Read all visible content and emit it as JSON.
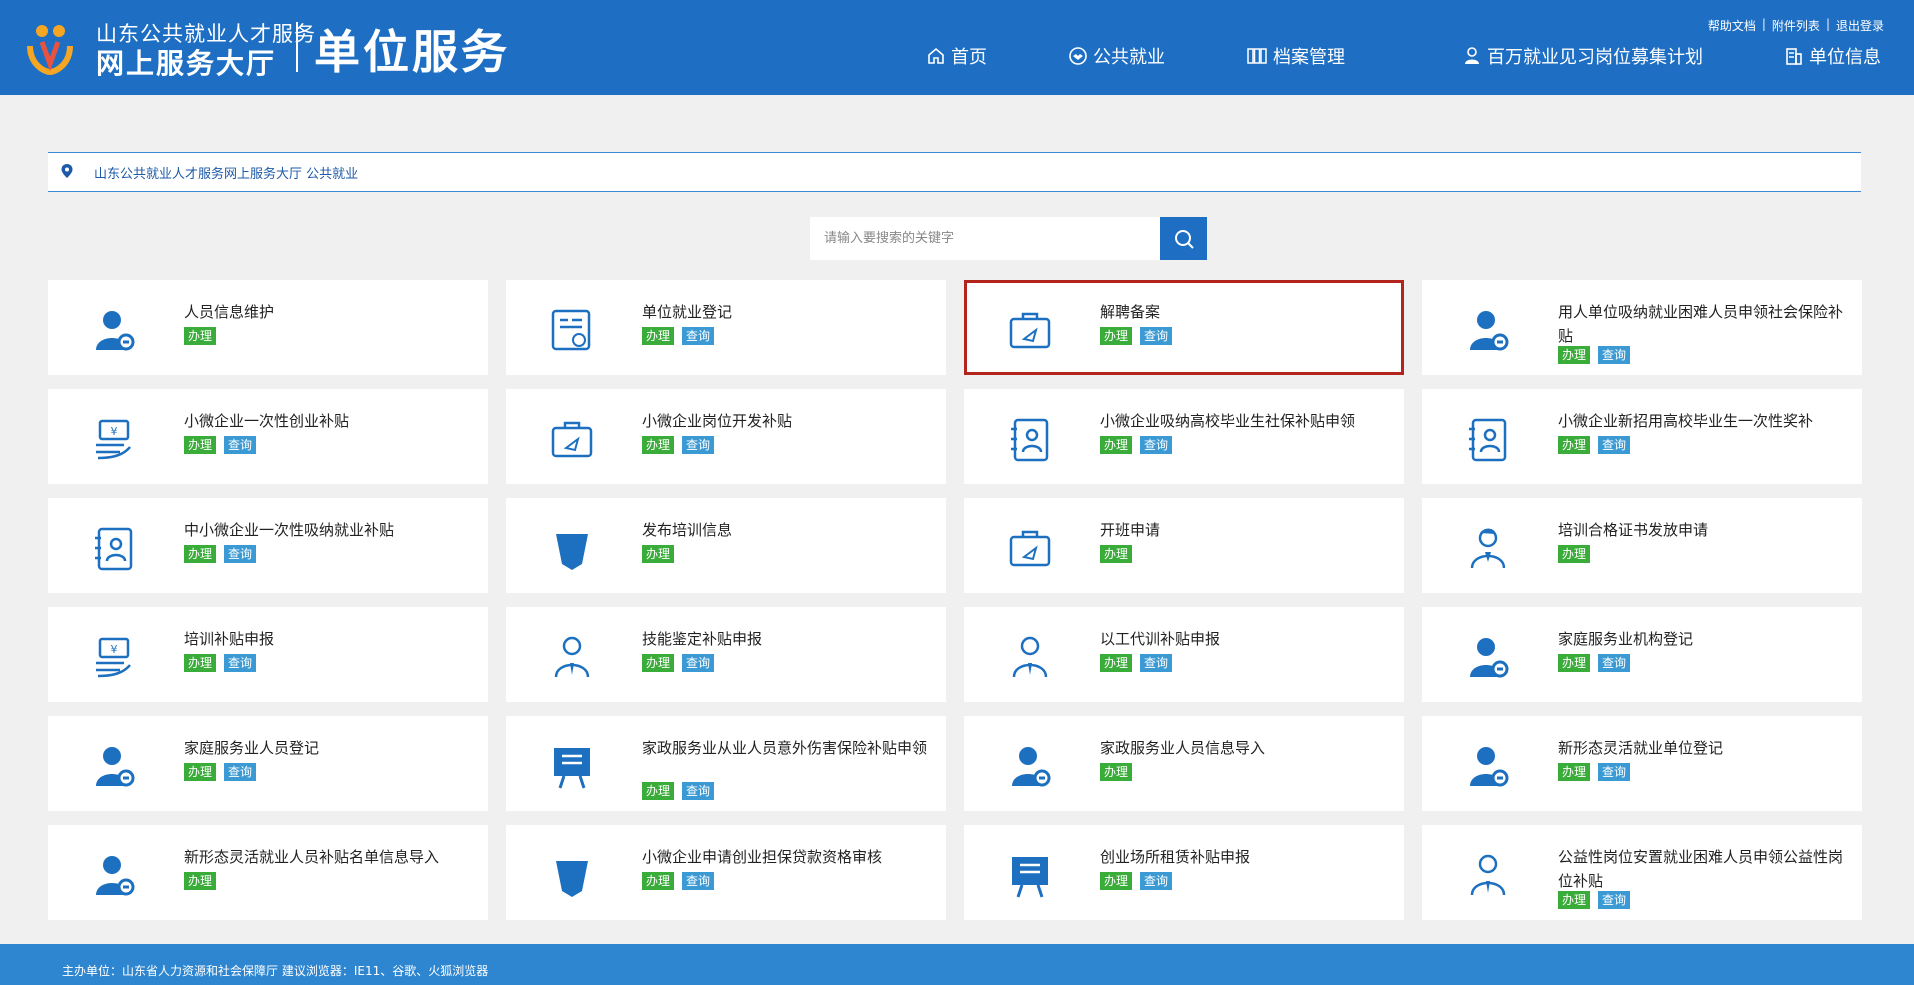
{
  "header": {
    "logo_line1": "山东公共就业人才服务",
    "logo_line2": "网上服务大厅",
    "portal_title": "单位服务",
    "top_links": [
      "帮助文档",
      "附件列表",
      "退出登录"
    ],
    "nav": [
      {
        "label": "首页",
        "icon": "home-icon"
      },
      {
        "label": "公共就业",
        "icon": "handshake-icon"
      },
      {
        "label": "档案管理",
        "icon": "archive-icon"
      },
      {
        "label": "百万就业见习岗位募集计划",
        "icon": "user-badge-icon"
      },
      {
        "label": "单位信息",
        "icon": "building-icon"
      }
    ]
  },
  "breadcrumb": {
    "text": "山东公共就业人才服务网上服务大厅 公共就业"
  },
  "search": {
    "placeholder": "请输入要搜索的关键字"
  },
  "badge_labels": {
    "do": "办理",
    "query": "查询"
  },
  "services": [
    {
      "title": "人员信息维护",
      "icon": "user-wrench-icon",
      "do": true,
      "query": false
    },
    {
      "title": "单位就业登记",
      "icon": "certificate-icon",
      "do": true,
      "query": true
    },
    {
      "title": "解聘备案",
      "icon": "briefcase-icon",
      "do": true,
      "query": true,
      "highlight": true
    },
    {
      "title": "用人单位吸纳就业困难人员申领社会保险补贴",
      "icon": "user-wrench-icon",
      "do": true,
      "query": true
    },
    {
      "title": "小微企业一次性创业补贴",
      "icon": "cash-hand-icon",
      "do": true,
      "query": true
    },
    {
      "title": "小微企业岗位开发补贴",
      "icon": "briefcase-icon",
      "do": true,
      "query": true
    },
    {
      "title": "小微企业吸纳高校毕业生社保补贴申领",
      "icon": "id-card-icon",
      "do": true,
      "query": true
    },
    {
      "title": "小微企业新招用高校毕业生一次性奖补",
      "icon": "id-card-icon",
      "do": true,
      "query": true
    },
    {
      "title": "中小微企业一次性吸纳就业补贴",
      "icon": "id-card-icon",
      "do": true,
      "query": true
    },
    {
      "title": "发布培训信息",
      "icon": "banner-icon",
      "do": true,
      "query": false
    },
    {
      "title": "开班申请",
      "icon": "briefcase-icon",
      "do": true,
      "query": false
    },
    {
      "title": "培训合格证书发放申请",
      "icon": "teacher-icon",
      "do": true,
      "query": false
    },
    {
      "title": "培训补贴申报",
      "icon": "cash-hand-icon",
      "do": true,
      "query": true
    },
    {
      "title": "技能鉴定补贴申报",
      "icon": "person-outline-icon",
      "do": true,
      "query": true
    },
    {
      "title": "以工代训补贴申报",
      "icon": "person-outline-icon",
      "do": true,
      "query": true
    },
    {
      "title": "家庭服务业机构登记",
      "icon": "user-wrench-icon",
      "do": true,
      "query": true
    },
    {
      "title": "家庭服务业人员登记",
      "icon": "user-wrench-icon",
      "do": true,
      "query": true
    },
    {
      "title": "家政服务业从业人员意外伤害保险补贴申领",
      "icon": "board-icon",
      "do": true,
      "query": true
    },
    {
      "title": "家政服务业人员信息导入",
      "icon": "user-wrench-icon",
      "do": true,
      "query": false
    },
    {
      "title": "新形态灵活就业单位登记",
      "icon": "user-wrench-icon",
      "do": true,
      "query": true
    },
    {
      "title": "新形态灵活就业人员补贴名单信息导入",
      "icon": "user-wrench-icon",
      "do": true,
      "query": false
    },
    {
      "title": "小微企业申请创业担保贷款资格审核",
      "icon": "banner-icon",
      "do": true,
      "query": true
    },
    {
      "title": "创业场所租赁补贴申报",
      "icon": "board-icon",
      "do": true,
      "query": true
    },
    {
      "title": "公益性岗位安置就业困难人员申领公益性岗位补贴",
      "icon": "person-outline-icon",
      "do": true,
      "query": true
    }
  ],
  "footer": {
    "text": "主办单位：山东省人力资源和社会保障厅   建议浏览器：IE11、谷歌、火狐浏览器"
  },
  "colors": {
    "header": "#1e6fc3",
    "do_badge": "#3aac3a",
    "query_badge": "#3b9ad4",
    "highlight": "#b3241c"
  }
}
